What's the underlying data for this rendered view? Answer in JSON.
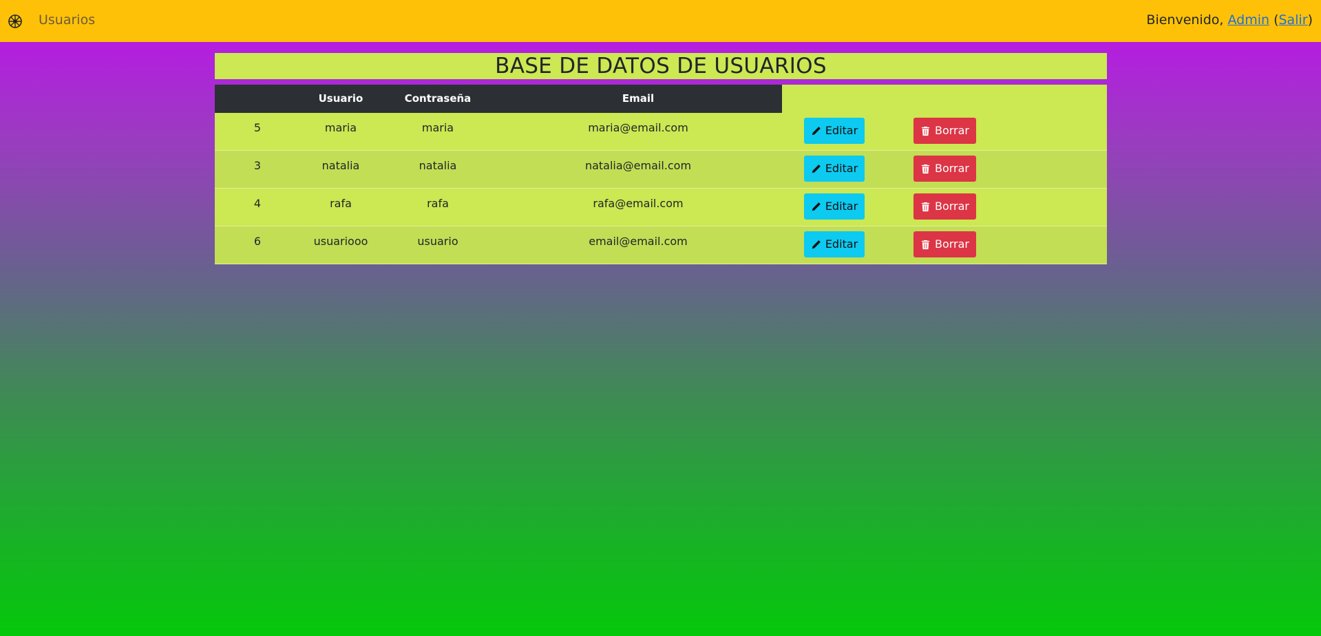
{
  "navbar": {
    "nav_link": "Usuarios",
    "welcome_prefix": "Bienvenido, ",
    "user_name": "Admin",
    "paren_open": " (",
    "logout_label": "Salir",
    "paren_close": ")",
    "color": "#ffc107"
  },
  "page": {
    "title": "BASE DE DATOS DE USUARIOS"
  },
  "table": {
    "headers": [
      "",
      "Usuario",
      "Contraseña",
      "Email"
    ],
    "edit_label": "Editar",
    "delete_label": "Borrar",
    "edit_icon": "pencil-icon",
    "delete_icon": "trash-icon",
    "rows": [
      {
        "id": "5",
        "usuario": "maria",
        "password": "maria",
        "email": "maria@email.com"
      },
      {
        "id": "3",
        "usuario": "natalia",
        "password": "natalia",
        "email": "natalia@email.com"
      },
      {
        "id": "4",
        "usuario": "rafa",
        "password": "rafa",
        "email": "rafa@email.com"
      },
      {
        "id": "6",
        "usuario": "usuariooo",
        "password": "usuario",
        "email": "email@email.com"
      }
    ]
  },
  "colors": {
    "title_bg": "#cce852",
    "header_bg": "#2c2f33",
    "edit_button": "#0dcaf0",
    "delete_button": "#dc3545"
  }
}
